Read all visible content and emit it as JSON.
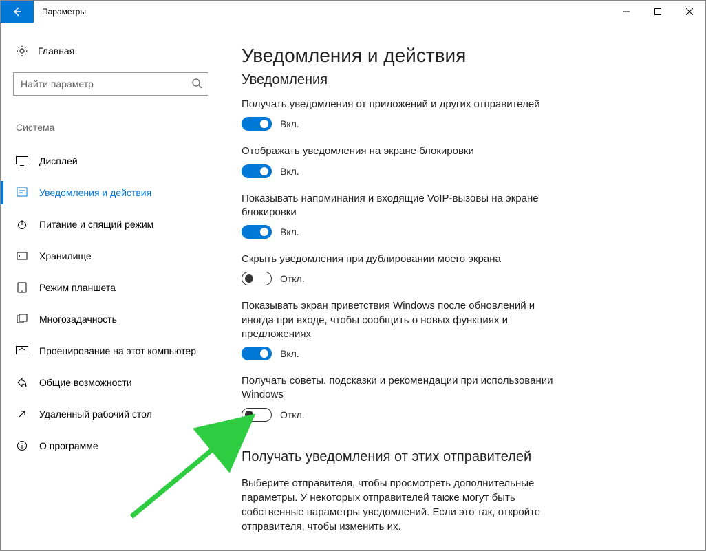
{
  "window": {
    "title": "Параметры"
  },
  "sidebar": {
    "home": "Главная",
    "search_placeholder": "Найти параметр",
    "category": "Система",
    "items": [
      {
        "label": "Дисплей"
      },
      {
        "label": "Уведомления и действия"
      },
      {
        "label": "Питание и спящий режим"
      },
      {
        "label": "Хранилище"
      },
      {
        "label": "Режим планшета"
      },
      {
        "label": "Многозадачность"
      },
      {
        "label": "Проецирование на этот компьютер"
      },
      {
        "label": "Общие возможности"
      },
      {
        "label": "Удаленный рабочий стол"
      },
      {
        "label": "О программе"
      }
    ]
  },
  "main": {
    "title": "Уведомления и действия",
    "section": "Уведомления",
    "on": "Вкл.",
    "off": "Откл.",
    "settings": [
      {
        "label": "Получать уведомления от приложений и других отправителей",
        "on": true
      },
      {
        "label": "Отображать уведомления на экране блокировки",
        "on": true
      },
      {
        "label": "Показывать напоминания и входящие VoIP-вызовы на экране блокировки",
        "on": true
      },
      {
        "label": "Скрыть уведомления при дублировании моего экрана",
        "on": false
      },
      {
        "label": "Показывать экран приветствия Windows после обновлений и иногда при входе, чтобы сообщить о новых функциях и предложениях",
        "on": true
      },
      {
        "label": "Получать советы, подсказки и рекомендации при использовании Windows",
        "on": false
      }
    ],
    "sub_heading": "Получать уведомления от этих отправителей",
    "sub_text": "Выберите отправителя, чтобы просмотреть дополнительные параметры. У некоторых отправителей также могут быть собственные параметры уведомлений. Если это так, откройте отправителя, чтобы изменить их."
  }
}
